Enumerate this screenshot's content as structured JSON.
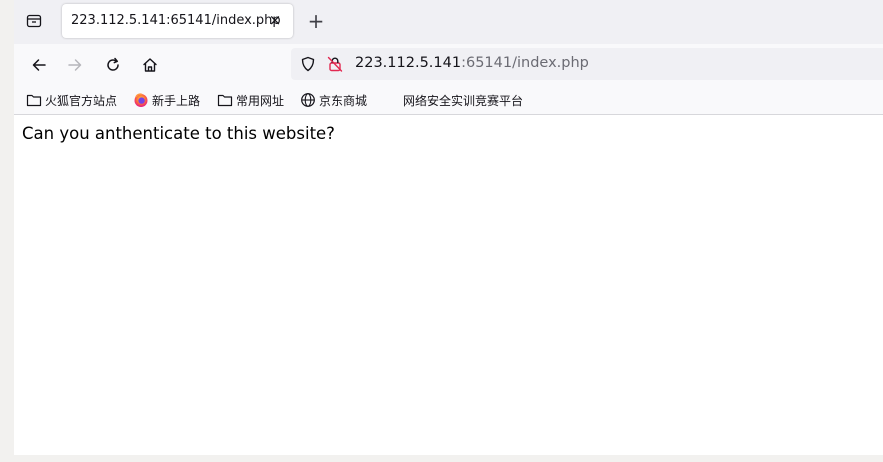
{
  "tabs": [
    {
      "title": "223.112.5.141:65141/index.php",
      "close_glyph": "×",
      "active": true
    }
  ],
  "new_tab_glyph": "+",
  "url": {
    "host": "223.112.5.141",
    "rest": ":65141/index.php"
  },
  "bookmarks": [
    {
      "label": "火狐官方站点",
      "icon": "folder-icon"
    },
    {
      "label": "新手上路",
      "icon": "firefox-icon"
    },
    {
      "label": "常用网址",
      "icon": "folder-icon"
    },
    {
      "label": "京东商城",
      "icon": "globe-icon"
    },
    {
      "label": "网络安全实训竞赛平台",
      "icon": ""
    }
  ],
  "page": {
    "text": "Can you anthenticate to this website?"
  },
  "colors": {
    "tabstrip": "#f0f0f4",
    "toolbar": "#f9f9fb",
    "urlbar": "#f0f0f4",
    "insecure_lock": "#e22850",
    "frame": "#f2f1ef"
  }
}
